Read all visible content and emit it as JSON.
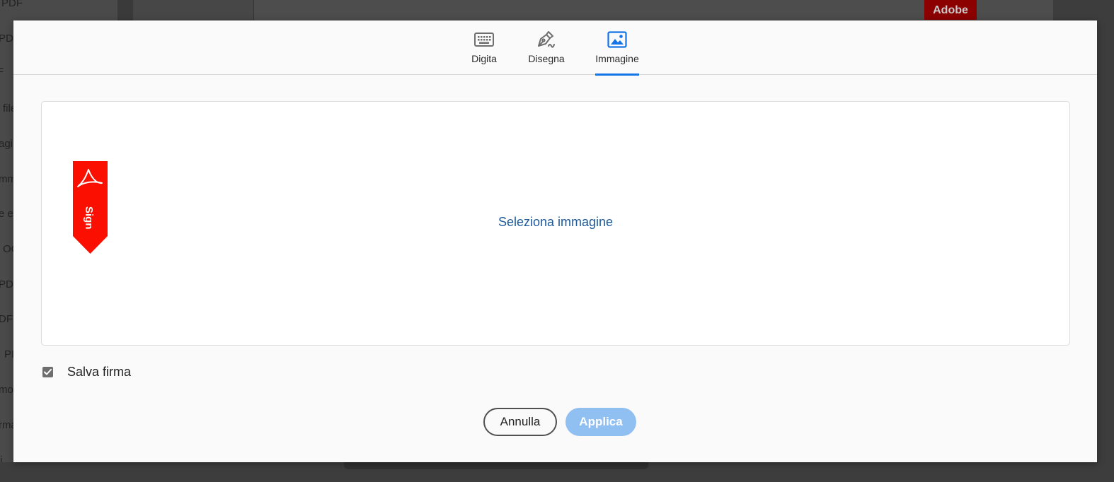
{
  "background": {
    "sidebar_items": [
      "PDF",
      "PD",
      "F",
      "file",
      "agi",
      "mm",
      "e e",
      "OC",
      "PD",
      "DF",
      "PI",
      "mod",
      "rma",
      "i"
    ],
    "adobe_label": "Adobe"
  },
  "dialog": {
    "tabs": [
      {
        "label": "Digita",
        "icon": "keyboard-icon",
        "active": false
      },
      {
        "label": "Disegna",
        "icon": "pen-draw-icon",
        "active": false
      },
      {
        "label": "Immagine",
        "icon": "image-icon",
        "active": true
      }
    ],
    "dropzone": {
      "logo_text": "Sign",
      "select_label": "Seleziona immagine"
    },
    "save_signature": {
      "label": "Salva firma",
      "checked": true
    },
    "buttons": {
      "cancel_label": "Annulla",
      "apply_label": "Applica"
    }
  },
  "colors": {
    "accent": "#1473e6",
    "link": "#1c5a9c",
    "apply_disabled": "#90bff2",
    "adobe_red": "#fa0f00"
  }
}
